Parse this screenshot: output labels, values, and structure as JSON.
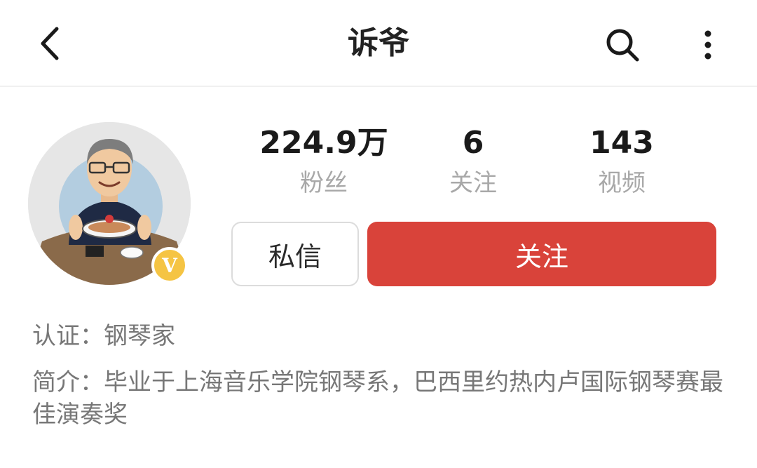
{
  "header": {
    "title": "诉爷",
    "back_icon": "chevron-left-icon",
    "search_icon": "search-icon",
    "more_icon": "more-vertical-icon"
  },
  "profile": {
    "verified_badge": "V",
    "stats": [
      {
        "value": "224.9万",
        "label": "粉丝"
      },
      {
        "value": "6",
        "label": "关注"
      },
      {
        "value": "143",
        "label": "视频"
      }
    ],
    "message_button": "私信",
    "follow_button": "关注",
    "certification": "认证：钢琴家",
    "intro": "简介：毕业于上海音乐学院钢琴系，巴西里约热内卢国际钢琴赛最佳演奏奖"
  },
  "colors": {
    "accent": "#d9433a",
    "badge": "#f5c443",
    "muted_text": "#a8a8a8"
  }
}
